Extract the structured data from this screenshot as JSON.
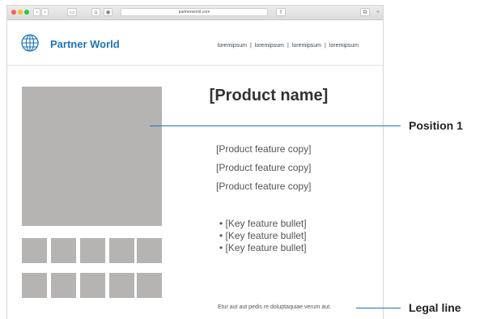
{
  "browser": {
    "url": "partnerworld.com",
    "back_glyph": "‹",
    "forward_glyph": "›",
    "sidebar_glyph": "▭",
    "home_glyph": "⌂",
    "privacy_glyph": "◉",
    "share_glyph": "⇪",
    "tabs_glyph": "⧉",
    "newtab_glyph": "+"
  },
  "header": {
    "logo_icon": "globe-icon",
    "logo_text": "Partner World",
    "nav": [
      "loremipsum",
      "loremipsum",
      "loremipsum",
      "loremipsum"
    ],
    "nav_separator": "|",
    "brand_color": "#1b75bb"
  },
  "product": {
    "name": "[Product name]",
    "features": [
      "[Product feature copy]",
      "[Product feature copy]",
      "[Product feature copy]"
    ],
    "bullets": [
      "• [Key feature bullet]",
      "• [Key feature bullet]",
      "• [Key feature bullet]"
    ],
    "legal": "Etur aut aut pedis re doluptaquiae verum aut."
  },
  "callouts": {
    "position": "Position 1",
    "legal": "Legal line"
  }
}
